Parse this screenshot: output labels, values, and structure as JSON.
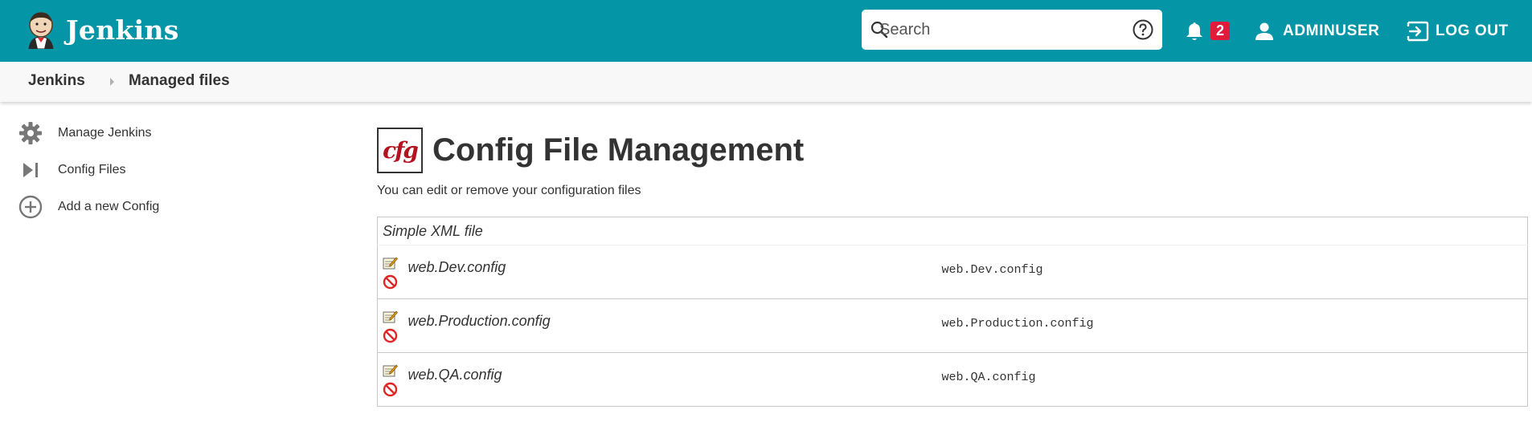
{
  "header": {
    "brand": "Jenkins",
    "search_placeholder": "Search",
    "notification_count": "2",
    "user_name": "ADMINUSER",
    "logout_label": "LOG OUT"
  },
  "breadcrumb": {
    "items": [
      "Jenkins",
      "Managed files"
    ]
  },
  "sidebar": {
    "items": [
      {
        "label": "Manage Jenkins",
        "icon": "gear-icon"
      },
      {
        "label": "Config Files",
        "icon": "skip-next-icon"
      },
      {
        "label": "Add a new Config",
        "icon": "add-circle-icon"
      }
    ]
  },
  "main": {
    "icon_text": "cfg",
    "title": "Config File Management",
    "description": "You can edit or remove your configuration files",
    "group": "Simple XML file",
    "files": [
      {
        "name": "web.Dev.config",
        "id": "web.Dev.config"
      },
      {
        "name": "web.Production.config",
        "id": "web.Production.config"
      },
      {
        "name": "web.QA.config",
        "id": "web.QA.config"
      }
    ]
  },
  "colors": {
    "header": "#0496a7",
    "badge": "#e01b3c",
    "breadcrumb_bg": "#f8f8f8"
  }
}
